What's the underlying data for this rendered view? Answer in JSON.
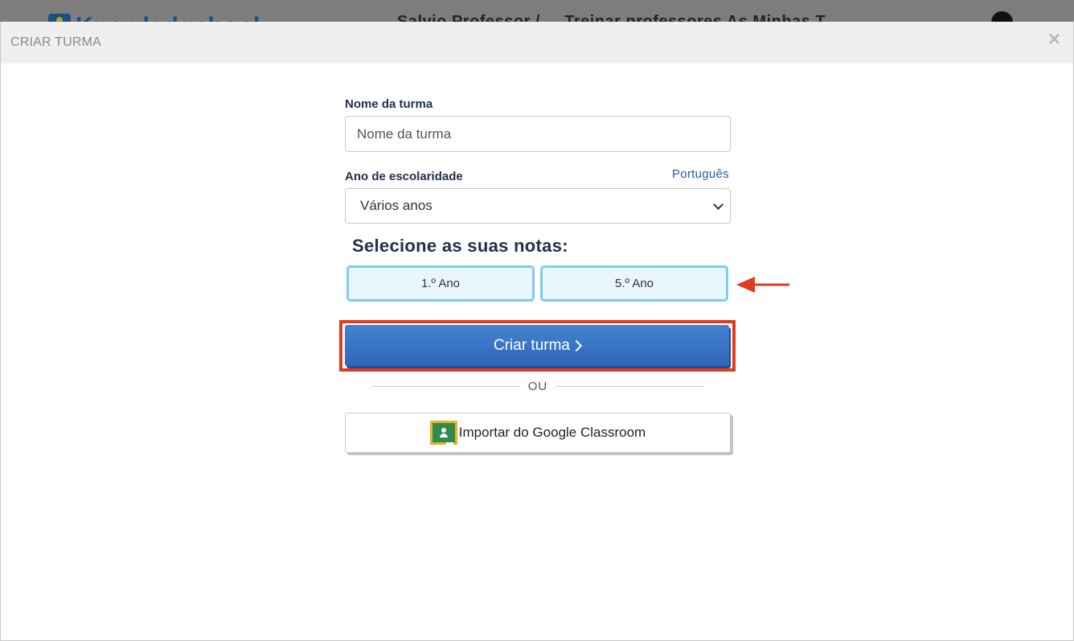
{
  "background": {
    "logo_text": "Knowledgehool",
    "nav_text": "Salvio Professor / ... Treinar professores  As Minhas T..."
  },
  "modal": {
    "title": "CRIAR TURMA",
    "close_glyph": "×"
  },
  "form": {
    "class_name_label": "Nome da turma",
    "class_name_placeholder": "Nome da turma",
    "school_year_label": "Ano de escolaridade",
    "language_link": "Português",
    "school_year_selected": "Vários anos",
    "grades_title": "Selecione as suas notas:",
    "grades": [
      "1.º Ano",
      "5.º Ano"
    ],
    "create_button": "Criar turma",
    "divider_text": "OU",
    "google_button": "Importar do Google Classroom"
  },
  "colors": {
    "accent_blue": "#3a76c8",
    "highlight_red": "#e23a1f",
    "grade_border": "#7dcdf2",
    "link_blue": "#1d5fa8"
  },
  "icons": {
    "close": "close-icon",
    "dropdown": "chevron-down-icon",
    "arrow": "arrow-left-icon",
    "google_classroom": "google-classroom-icon",
    "submit_chevron": "chevron-right-icon"
  }
}
